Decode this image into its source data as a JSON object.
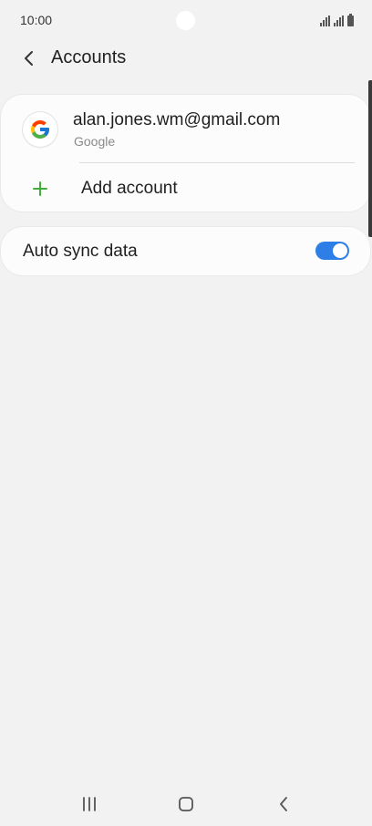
{
  "status_bar": {
    "time": "10:00"
  },
  "header": {
    "title": "Accounts"
  },
  "accounts": [
    {
      "email": "alan.jones.wm@gmail.com",
      "type": "Google",
      "icon": "google-logo-icon"
    }
  ],
  "add_account": {
    "label": "Add account",
    "icon": "plus-icon",
    "icon_color": "#3fae3a"
  },
  "auto_sync": {
    "label": "Auto sync data",
    "enabled": true,
    "accent_color": "#2d7ee6"
  },
  "navigation": {
    "buttons": [
      "recent-apps-icon",
      "home-icon",
      "back-icon"
    ]
  }
}
